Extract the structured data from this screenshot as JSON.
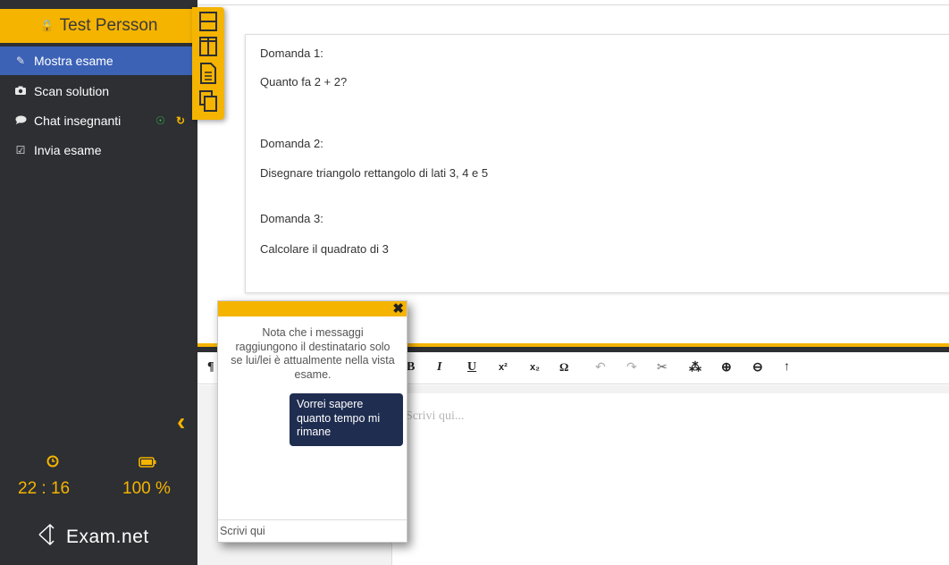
{
  "sidebar": {
    "user_name": "Test Persson",
    "items": [
      {
        "label": "Mostra esame",
        "icon": "edit-icon"
      },
      {
        "label": "Scan solution",
        "icon": "camera-icon"
      },
      {
        "label": "Chat insegnanti",
        "icon": "chat-icon"
      },
      {
        "label": "Invia esame",
        "icon": "check-square-icon"
      }
    ],
    "time": "22 : 16",
    "battery": "100 %",
    "logo": "Exam.net"
  },
  "questions": [
    {
      "title": "Domanda 1:",
      "text": "Quanto fa 2 + 2?"
    },
    {
      "title": "Domanda 2:",
      "text": "Disegnare triangolo rettangolo di lati 3, 4 e 5"
    },
    {
      "title": "Domanda 3:",
      "text": "Calcolare il quadrato di 3"
    }
  ],
  "toolbar": {
    "paragraph": "¶",
    "bold": "B",
    "italic": "I",
    "underline": "U",
    "superscript": "x²",
    "subscript": "x₂",
    "omega": "Ω",
    "undo": "↶",
    "redo": "↷",
    "cut": "✂",
    "puzzle": "⁂",
    "zoom_in": "⊕",
    "zoom_out": "⊖",
    "up": "↑"
  },
  "editor": {
    "placeholder": "Scrivi qui..."
  },
  "chat": {
    "notice": "Nota che i messaggi raggiungono il destinatario solo se lui/lei è attualmente nella vista esame.",
    "message": "Vorrei sapere quanto tempo mi rimane",
    "input_placeholder": "Scrivi qui"
  },
  "colors": {
    "accent": "#f5b400",
    "sidebar": "#2d2f33",
    "active": "#3c62b6",
    "bubble": "#1f2d50"
  }
}
